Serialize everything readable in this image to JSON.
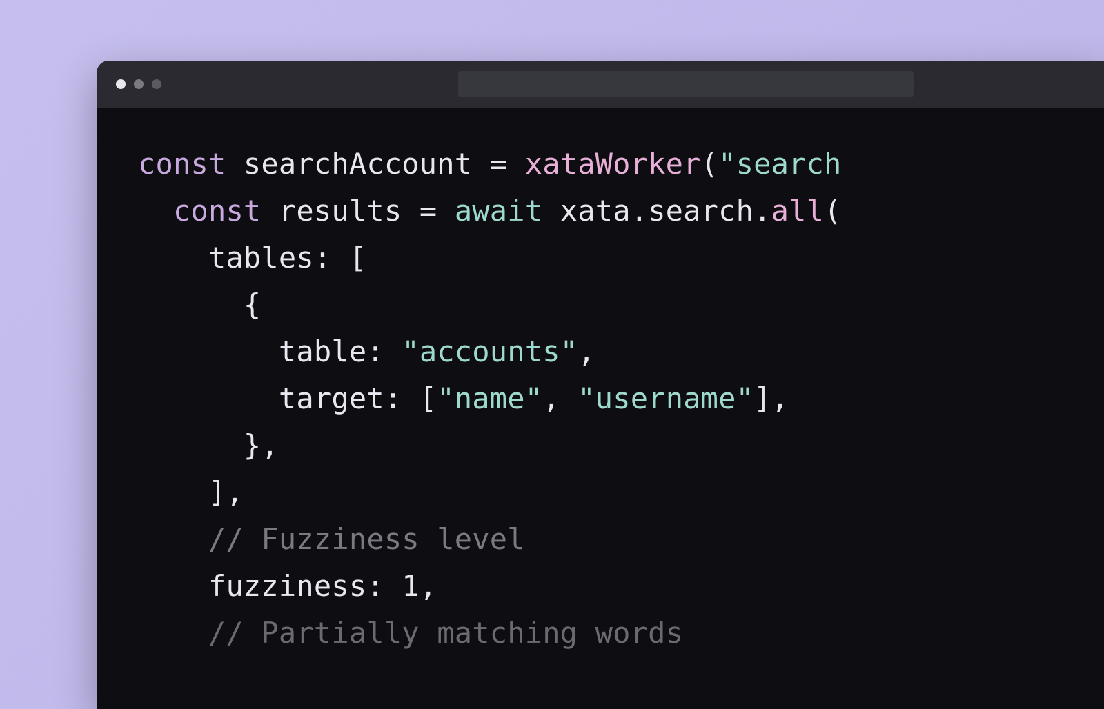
{
  "code": {
    "line1": {
      "kw": "const",
      "ident": " searchAccount ",
      "op": "=",
      "sp": " ",
      "fn": "xataWorker",
      "paren": "(",
      "q1": "\"",
      "strPartial": "search"
    },
    "line2": {
      "indent": "  ",
      "kw": "const",
      "ident": " results ",
      "op": "=",
      "sp": " ",
      "await": "await",
      "obj": " xata",
      "dot1": ".",
      "prop1": "search",
      "dot2": ".",
      "method": "all",
      "paren": "("
    },
    "line3": {
      "indent": "    ",
      "key": "tables",
      "colon": ":",
      "sp": " ",
      "bracket": "["
    },
    "line4": {
      "indent": "      ",
      "brace": "{"
    },
    "line5": {
      "indent": "        ",
      "key": "table",
      "colon": ":",
      "sp": " ",
      "q1": "\"",
      "str": "accounts",
      "q2": "\"",
      "comma": ","
    },
    "line6": {
      "indent": "        ",
      "key": "target",
      "colon": ":",
      "sp": " ",
      "b1": "[",
      "q1": "\"",
      "s1": "name",
      "q2": "\"",
      "c1": ",",
      "sp2": " ",
      "q3": "\"",
      "s2": "username",
      "q4": "\"",
      "b2": "]",
      "comma": ","
    },
    "line7": {
      "indent": "      ",
      "brace": "},"
    },
    "line8": {
      "indent": "    ",
      "bracket": "],"
    },
    "line9": {
      "indent": "    ",
      "comment": "// Fuzziness level"
    },
    "line10": {
      "indent": "    ",
      "key": "fuzziness",
      "colon": ":",
      "sp": " ",
      "num": "1",
      "comma": ","
    },
    "line11": {
      "indent": "    ",
      "comment": "// Partially matching words"
    }
  },
  "colors": {
    "keyword": "#c8a9e0",
    "text": "#e8e6ef",
    "function": "#e8b0d8",
    "string": "#9ed9cf",
    "comment": "#7a7a82",
    "bg": "#0e0d11",
    "titlebar": "#2a2a30"
  }
}
